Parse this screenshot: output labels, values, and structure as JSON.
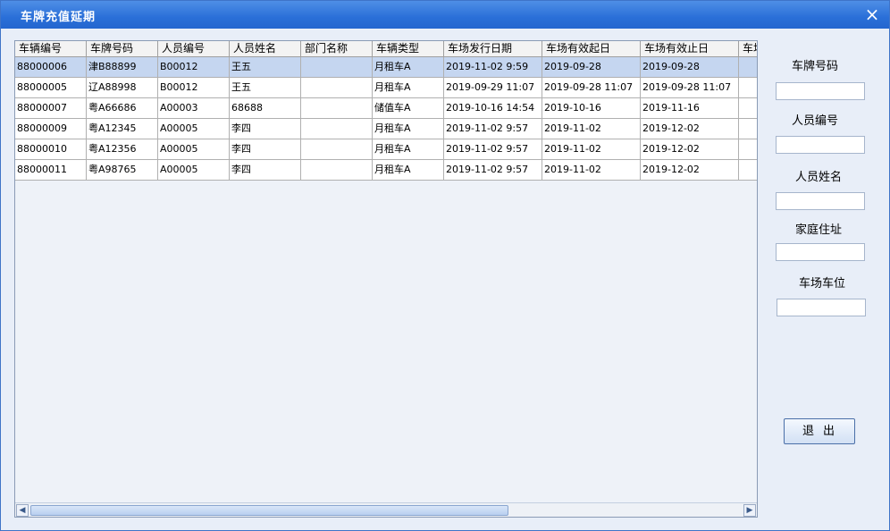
{
  "window": {
    "title": "车牌充值延期",
    "close_icon": "×"
  },
  "table": {
    "columns": [
      "车辆编号",
      "车牌号码",
      "人员编号",
      "人员姓名",
      "部门名称",
      "车辆类型",
      "车场发行日期",
      "车场有效起日",
      "车场有效止日",
      "车场"
    ],
    "rows": [
      [
        "88000006",
        "津B88899",
        "B00012",
        "王五",
        "",
        "月租车A",
        "2019-11-02 9:59",
        "2019-09-28",
        "2019-09-28",
        ""
      ],
      [
        "88000005",
        "辽A88998",
        "B00012",
        "王五",
        "",
        "月租车A",
        "2019-09-29 11:07",
        "2019-09-28 11:07",
        "2019-09-28 11:07",
        ""
      ],
      [
        "88000007",
        "粤A66686",
        "A00003",
        "68688",
        "",
        "储值车A",
        "2019-10-16 14:54",
        "2019-10-16",
        "2019-11-16",
        ""
      ],
      [
        "88000009",
        "粤A12345",
        "A00005",
        "李四",
        "",
        "月租车A",
        "2019-11-02 9:57",
        "2019-11-02",
        "2019-12-02",
        ""
      ],
      [
        "88000010",
        "粤A12356",
        "A00005",
        "李四",
        "",
        "月租车A",
        "2019-11-02 9:57",
        "2019-11-02",
        "2019-12-02",
        ""
      ],
      [
        "88000011",
        "粤A98765",
        "A00005",
        "李四",
        "",
        "月租车A",
        "2019-11-02 9:57",
        "2019-11-02",
        "2019-12-02",
        ""
      ]
    ],
    "selected_row": 0
  },
  "side": {
    "plate_label": "车牌号码",
    "person_no_label": "人员编号",
    "person_name_label": "人员姓名",
    "address_label": "家庭住址",
    "space_label": "车场车位",
    "exit_label": "退出"
  },
  "scroll": {
    "left_icon": "◀",
    "right_icon": "▶"
  }
}
